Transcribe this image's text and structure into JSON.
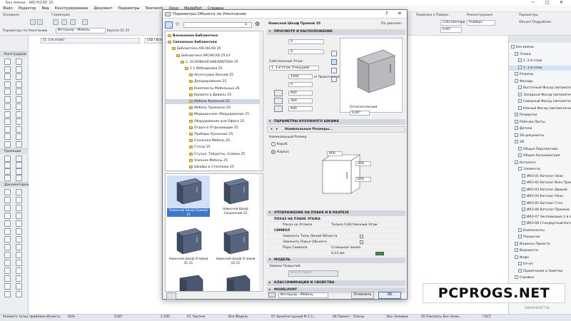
{
  "app": {
    "title": "Без имени - ARCHICAD 25",
    "menu": [
      "Файл",
      "Редактор",
      "Вид",
      "Конструирование",
      "Документ",
      "Параметры",
      "Teamwork",
      "Окно",
      "ModelPort",
      "Справка"
    ]
  },
  "toolbar": {
    "label_left": "Основное",
    "label_geometry": "Геометрия",
    "label_default": "Параметры по Умолчанию",
    "label_place": "Интерьер - Мебель",
    "label_layer": "Слой:",
    "object_name": "Кресло 01 25",
    "label_elevation": "Привязка к Поверх.",
    "label_elevation2": "Отметка",
    "elevation_value": "0,00\"",
    "label_floor": "Собственный",
    "value_floor": "0,00\"",
    "label_renovation": "Реконструкция",
    "value_renovation": "Универс",
    "label_objparams": "Параметры",
    "value_objparams": "Объект Подробнее"
  },
  "toolbox": {
    "headers": [
      "Конструиров.",
      "Проекции",
      "Документиров."
    ]
  },
  "drawing": {
    "tabs": [
      "[1. 1-й этаж]",
      "[3D / Все]"
    ]
  },
  "navigator": {
    "items": [
      {
        "label": "Без имени",
        "indent": 0
      },
      {
        "label": "Этажи",
        "indent": 1
      },
      {
        "label": "2. 2-й этаж",
        "indent": 2
      },
      {
        "label": "1. 1-й этаж",
        "indent": 2,
        "selected": true
      },
      {
        "label": "Разрезы",
        "indent": 1
      },
      {
        "label": "Фасады",
        "indent": 1
      },
      {
        "label": "Восточный Фасад (автоматически Пе",
        "indent": 2
      },
      {
        "label": "Западный Фасад (автоматически Пе",
        "indent": 2
      },
      {
        "label": "Северный Фасад (автоматически Пе",
        "indent": 2
      },
      {
        "label": "Южный Фасад (автоматически Пере",
        "indent": 2
      },
      {
        "label": "Развертки",
        "indent": 1
      },
      {
        "label": "Рабочие Листы",
        "indent": 1
      },
      {
        "label": "Детали",
        "indent": 1
      },
      {
        "label": "3D-документы",
        "indent": 1
      },
      {
        "label": "3D",
        "indent": 1
      },
      {
        "label": "Общая Перспектива",
        "indent": 2
      },
      {
        "label": "Общая Аксонометрия",
        "indent": 2
      },
      {
        "label": "Каталоги",
        "indent": 1
      },
      {
        "label": "Элементы",
        "indent": 2
      },
      {
        "label": "ИКЭ-01 Каталог Окон",
        "indent": 3
      },
      {
        "label": "ИКЭ-02 Каталог Всех Проемов",
        "indent": 3
      },
      {
        "label": "ИКЭ-03 Каталог Дверей",
        "indent": 3
      },
      {
        "label": "ИКЭ-04 Каталог Окон",
        "indent": 3
      },
      {
        "label": "ИКЭ-05 Каталог Стен",
        "indent": 3
      },
      {
        "label": "ИКЭ-06 Каталог Проемов",
        "indent": 3
      },
      {
        "label": "ИКЭ-07 Экспликация 1-й этаж",
        "indent": 3
      },
      {
        "label": "ИКЭ-08 Стандартный Каталог Мат",
        "indent": 3
      },
      {
        "label": "Компоненты",
        "indent": 2
      },
      {
        "label": "Покрытия",
        "indent": 2
      },
      {
        "label": "Индексы Проекта",
        "indent": 1
      },
      {
        "label": "Ведомости",
        "indent": 1
      },
      {
        "label": "Инфо",
        "indent": 1
      },
      {
        "label": "Отчет",
        "indent": 2
      },
      {
        "label": "Примечания и Заметки",
        "indent": 2
      },
      {
        "label": "Справка",
        "indent": 1
      }
    ],
    "footer_label": "Параметры...",
    "footer_sub": "GRAPHISOFT ID"
  },
  "status": {
    "hint": "Укажите точку привязки объекта.",
    "zoom": "92%",
    "angle": "0,00°",
    "scale": "1:100",
    "layer_combo": "01 Чертеж",
    "model": "Вся Модель",
    "set1": "07 Архитектурный М 1:1...",
    "set2": "04 Проект - Планы",
    "set3": "Все Заливки",
    "set4": "05 Показать Все Элем...",
    "gost": "ГОСТ"
  },
  "dialog": {
    "title": "Параметры Объекта по Умолчанию",
    "lib_tree": [
      {
        "label": "Вложенная Библиотека",
        "indent": 0,
        "bold": true
      },
      {
        "label": "Связанные Библиотеки",
        "indent": 0,
        "bold": true
      },
      {
        "label": "Библиотека ARCHICAD 25",
        "indent": 1
      },
      {
        "label": "Библиотека ARCHICAD 25.lcf",
        "indent": 2
      },
      {
        "label": "1. ОСНОВНАЯ БИБЛИОТЕКА 25",
        "indent": 3
      },
      {
        "label": "1.1 Меблировка 25",
        "indent": 4
      },
      {
        "label": "Аксессуары Ванной 25",
        "indent": 5
      },
      {
        "label": "Декорирование 25",
        "indent": 5
      },
      {
        "label": "Комплекты Мебельные 25",
        "indent": 5
      },
      {
        "label": "Кровати и Диваны 25",
        "indent": 5
      },
      {
        "label": "Мебель Кухонная 25",
        "indent": 5,
        "selected": true
      },
      {
        "label": "Мебель Приемная 25",
        "indent": 5
      },
      {
        "label": "Медицинское Оборудование 25",
        "indent": 5
      },
      {
        "label": "Оборудование для Офиса 25",
        "indent": 5
      },
      {
        "label": "Отдых и Отдыхающие 25",
        "indent": 5
      },
      {
        "label": "Приборы Кухонные 25",
        "indent": 5
      },
      {
        "label": "Спальная Мебель 25",
        "indent": 5
      },
      {
        "label": "Столы 25",
        "indent": 5
      },
      {
        "label": "Стулья, Табуреты, Скамьи 25",
        "indent": 5
      },
      {
        "label": "Уличная Мебель 25",
        "indent": 5
      },
      {
        "label": "Шкафы и Стеллажи 25",
        "indent": 5
      }
    ],
    "thumbs": [
      {
        "label": "Навесной Шкаф Прямой 25",
        "selected": true
      },
      {
        "label": "Навесной Шкаф Скошенный 25"
      },
      {
        "label": "Навесной Шкаф Угловой 01 25"
      },
      {
        "label": "Навесной Шкаф Угловой 02 25"
      },
      {
        "label": "",
        "shape": "corner"
      },
      {
        "label": "",
        "shape": "corner"
      }
    ],
    "props": {
      "object_name": "Навесной Шкаф Прямой 25",
      "object_default": "По умолчан.",
      "sec_preview": "ПРОСМОТР И РАСПОЛОЖЕНИЕ",
      "field_top": "0",
      "field_zero": "0",
      "own_floor_label": "Собственный Этаж:",
      "own_floor_value": "1. 1-й этаж (Текущий)",
      "field_1400": "1400",
      "relative_label": "от Проектного Нуля",
      "field_0b": "0",
      "field_600a": "600",
      "field_300": "300",
      "field_600b": "600",
      "relative_value": "Относительный",
      "angle_value": "0,00°",
      "sec_params": "ПАРАМЕТРЫ КУХОННОГО ШКАФА",
      "params_tab": "Номинальные Размеры...",
      "nominal_label": "Номинальный Размер",
      "radio_box": "Короб",
      "radio_frame": "Каркас",
      "dim_600a": "600",
      "dim_300": "300",
      "dim_600b": "600",
      "sec_plan": "ОТОБРАЖЕНИЕ НА ПЛАНЕ И В РАЗРЕЗЕ",
      "sub_floorplan": "ПОКАЗ НА ПЛАНЕ ЭТАЖА",
      "row_show_on_floor": "Показ на Этажах",
      "row_show_on_floor_val": "Только Собственный Этаж",
      "sub_symbol": "СИМВОЛ",
      "row_line_type": "Заменить Типы Линий Объекта",
      "row_pen": "Заменить Перья Объекта",
      "row_symbol_pen": "Перо Символа",
      "row_symbol_pen_val": "Сплошная линия",
      "row_symbol_pen_num": "0,13 мм",
      "sec_model": "МОДЕЛЬ",
      "model_surface_label": "Замена Покрытий",
      "model_surface_value": "Отсутствует",
      "sec_class": "КЛАССИФИКАЦИЯ И СВОЙСТВА",
      "sec_modelport": "MODELPORT",
      "layer_value": "Интерьер - Мебель",
      "btn_cancel": "Отменить",
      "btn_ok": "OK"
    }
  },
  "watermark": "PCPROGS.NET"
}
